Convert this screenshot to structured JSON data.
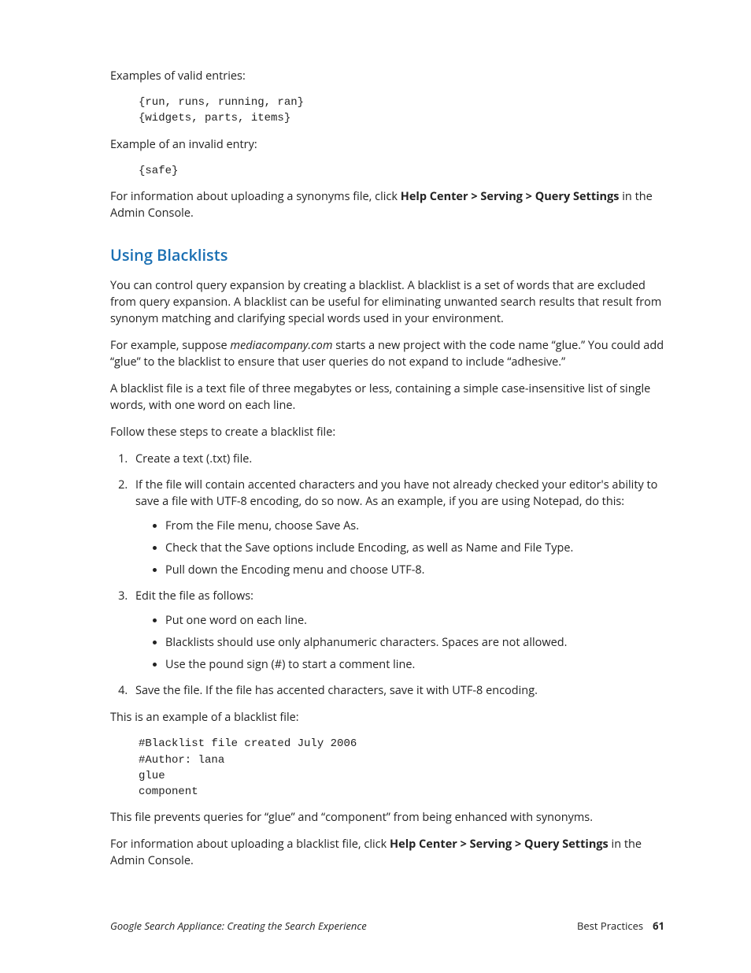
{
  "paragraphs": {
    "validIntro": "Examples of valid entries:",
    "validCode": "{run, runs, running, ran}\n{widgets, parts, items}",
    "invalidIntro": "Example of an invalid entry:",
    "invalidCode": "{safe}",
    "uploadSynonymsPre": "For information about uploading a synonyms file, click ",
    "uploadSynonymsBold": "Help Center > Serving > Query Settings",
    "uploadSynonymsPost": " in the Admin Console.",
    "heading": "Using Blacklists",
    "p1": "You can control query expansion by creating a blacklist. A blacklist is a set of words that are excluded from query expansion. A blacklist can be useful for eliminating unwanted search results that result from synonym matching and clarifying special words used in your environment.",
    "p2a": "For example, suppose ",
    "p2b": "mediacompany.com",
    "p2c": " starts a new project with the code name “glue.” You could add “glue” to the blacklist to ensure that user queries do not expand to include “adhesive.”",
    "p3": "A blacklist file is a text file of three megabytes or less, containing a simple case-insensitive list of single words, with one word on each line.",
    "p4": "Follow these steps to create a blacklist file:",
    "ol1": "Create a text (.txt) file.",
    "ol2": "If the file will contain accented characters and you have not already checked your editor's ability to save a file with UTF-8 encoding, do so now. As an example, if you are using Notepad, do this:",
    "ol2a": "From the File menu, choose Save As.",
    "ol2b": "Check that the Save options include Encoding, as well as Name and File Type.",
    "ol2c": "Pull down the Encoding menu and choose UTF-8.",
    "ol3": "Edit the file as follows:",
    "ol3a": "Put one word on each line.",
    "ol3b": "Blacklists should use only alphanumeric characters. Spaces are not allowed.",
    "ol3c": "Use the pound sign (#) to start a comment line.",
    "ol4": "Save the file. If the file has accented characters, save it with UTF-8 encoding.",
    "exampleIntro": "This is an example of a blacklist file:",
    "exampleCode": "#Blacklist file created July 2006\n#Author: lana\nglue\ncomponent",
    "p5": "This file prevents queries for “glue” and “component” from being enhanced with synonyms.",
    "p6a": "For information about uploading a blacklist file, click ",
    "p6b": "Help Center > Serving > Query Settings",
    "p6c": " in the Admin Console."
  },
  "footer": {
    "left": "Google Search Appliance: Creating the Search Experience",
    "rightLabel": "Best Practices",
    "pageNum": "61"
  }
}
